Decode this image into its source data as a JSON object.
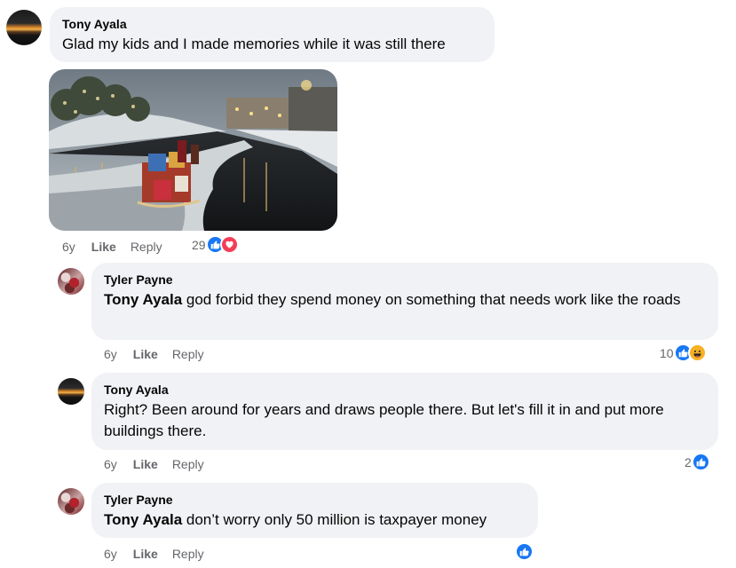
{
  "comments": [
    {
      "author": "Tony Ayala",
      "text": "Glad my kids and I made memories while it was still there",
      "time": "6y",
      "like": "Like",
      "reply": "Reply",
      "reaction_count": "29"
    },
    {
      "author": "Tyler Payne",
      "mention": "Tony Ayala",
      "text": " god forbid they spend money on something that needs work like the roads",
      "time": "6y",
      "like": "Like",
      "reply": "Reply",
      "reaction_count": "10"
    },
    {
      "author": "Tony Ayala",
      "text": "Right? Been around for years and draws people there. But let's fill it in and put more buildings there.",
      "time": "6y",
      "like": "Like",
      "reply": "Reply",
      "reaction_count": "2"
    },
    {
      "author": "Tyler Payne",
      "mention": "Tony Ayala",
      "text": " don’t worry only 50 million is taxpayer money",
      "time": "6y",
      "like": "Like",
      "reply": "Reply"
    }
  ],
  "icons": {
    "like": "like-reaction-icon",
    "love": "love-reaction-icon",
    "haha": "haha-reaction-icon"
  },
  "colors": {
    "bubble": "#f0f2f5",
    "like_blue": "#1877f2",
    "love_red": "#f33e58",
    "haha_yellow": "#f7b125",
    "meta_gray": "#65676b"
  }
}
